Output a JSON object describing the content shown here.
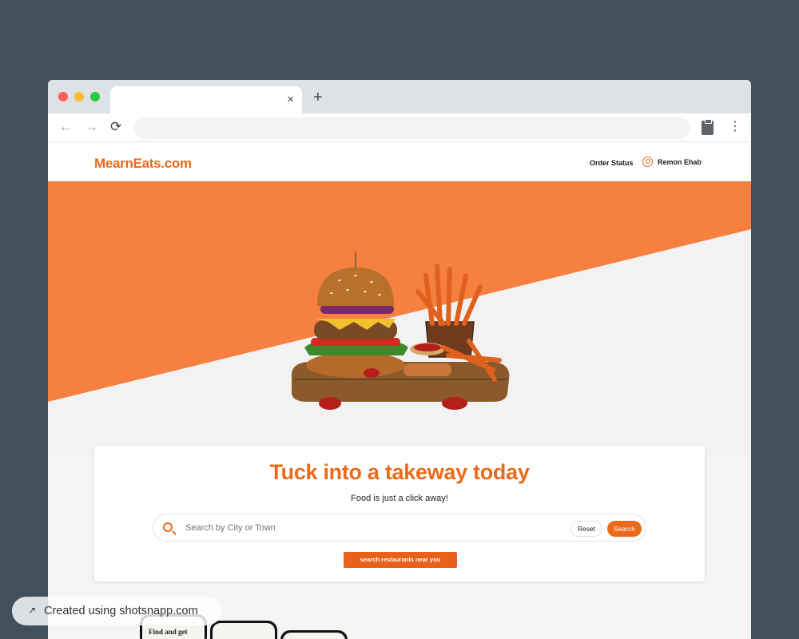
{
  "browser": {
    "tab_close": "×",
    "new_tab": "+",
    "back": "←",
    "forward": "→",
    "reload": "⟳",
    "menu": "⋮"
  },
  "header": {
    "logo": "MearnEats.com",
    "order_status": "Order Status",
    "user_name": "Remon Ehab"
  },
  "hero": {
    "primary_color": "#f5803f",
    "image": "burger-and-fries-icon"
  },
  "search_card": {
    "headline": "Tuck into a takeway today",
    "subline": "Food is just a click away!",
    "search_placeholder": "Search by City or Town",
    "reset_label": "Reset",
    "search_label": "Search",
    "near_label": "search restaurants near you"
  },
  "phones": {
    "phone1_text": "Find and get"
  },
  "badge": {
    "icon": "↗",
    "text": "Created using shotsnapp.com"
  },
  "colors": {
    "accent": "#ea6a1a",
    "backdrop": "#40515c"
  }
}
